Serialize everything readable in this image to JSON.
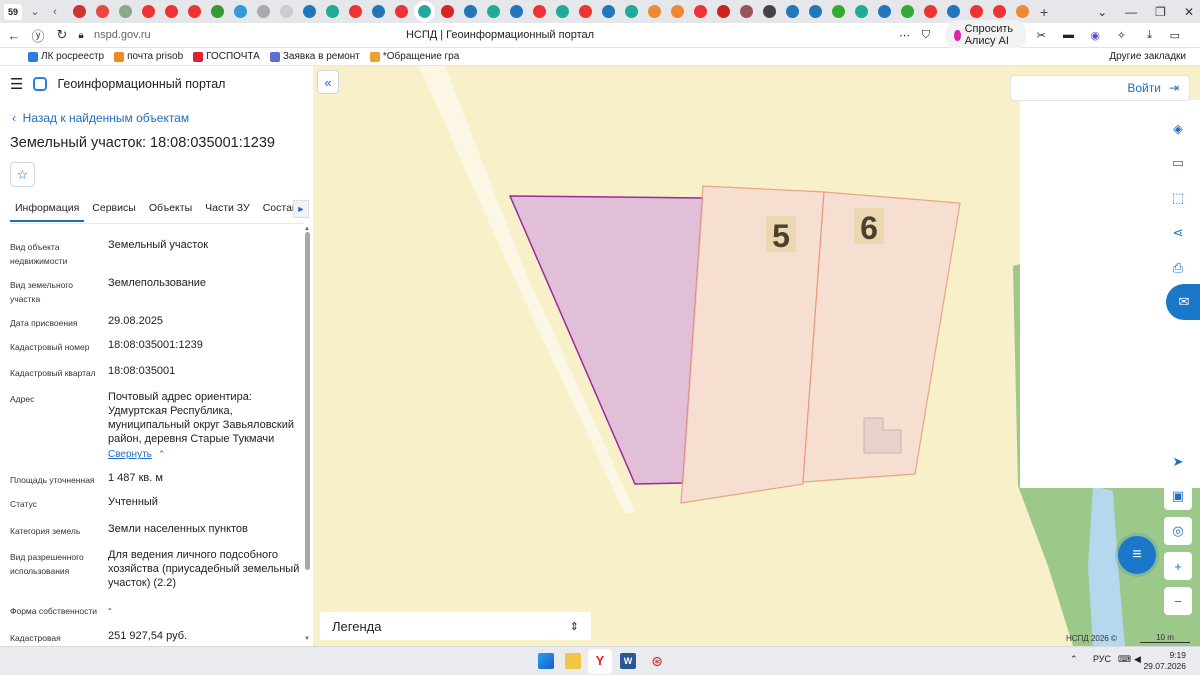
{
  "browser": {
    "tab_count": "59",
    "url": "nspd.gov.ru",
    "page_title": "НСПД | Геоинформационный портал",
    "ask_alice_label": "Спросить Алису AI",
    "bookmarks": [
      {
        "label": "ЛК росреестр",
        "color": "#2a7de1"
      },
      {
        "label": "почта prisob",
        "color": "#f08a1c"
      },
      {
        "label": "ГОСПОЧТА",
        "color": "#d23"
      },
      {
        "label": "Заявка в ремонт",
        "color": "#5a6fd1"
      },
      {
        "label": "*Обращение гра",
        "color": "#e8a32a"
      }
    ],
    "other_bookmarks": "Другие закладки",
    "favicon_colors": [
      "#c33",
      "#e44",
      "#8a8",
      "#e33",
      "#e33",
      "#e33",
      "#393",
      "#39d",
      "#aaa",
      "#ccc",
      "#27b",
      "#2a9",
      "#e33",
      "#27b",
      "#e33",
      "#2a9",
      "#d22",
      "#27b",
      "#2a9",
      "#27b",
      "#e33",
      "#2a9",
      "#e33",
      "#27b",
      "#2a9",
      "#e83",
      "#e83",
      "#e33",
      "#c22",
      "#955",
      "#444",
      "#27b",
      "#27b",
      "#3a3",
      "#2a9",
      "#27b",
      "#3a3",
      "#e33",
      "#27b",
      "#e33",
      "#e33",
      "#e83"
    ]
  },
  "panel": {
    "app_title": "Геоинформационный портал",
    "back_link": "Назад к найденным объектам",
    "title": "Земельный участок: 18:08:035001:1239",
    "tabs": [
      "Информация",
      "Сервисы",
      "Объекты",
      "Части ЗУ",
      "Состав"
    ],
    "collapse_link": "Свернуть",
    "fields": [
      {
        "label": "Вид объекта недвижимости",
        "value": "Земельный участок"
      },
      {
        "label": "Вид земельного участка",
        "value": "Землепользование"
      },
      {
        "label": "Дата присвоения",
        "value": "29.08.2025"
      },
      {
        "label": "Кадастровый номер",
        "value": "18:08:035001:1239"
      },
      {
        "label": "Кадастровый квартал",
        "value": "18:08:035001"
      },
      {
        "label": "Адрес",
        "value": "Почтовый адрес ориентира: Удмуртская Республика, муниципальный округ Завьяловский район, деревня Старые Тукмачи"
      },
      {
        "label": "Площадь уточненная",
        "value": "1 487 кв. м"
      },
      {
        "label": "Статус",
        "value": "Учтенный"
      },
      {
        "label": "Категория земель",
        "value": "Земли населенных пунктов"
      },
      {
        "label": "Вид разрешенного использования",
        "value": "Для ведения личного подсобного хозяйства (приусадебный земельный участок) (2.2)"
      },
      {
        "label": "Форма собственности",
        "value": "-"
      },
      {
        "label": "Кадастровая",
        "value": "251 927,54 руб."
      }
    ]
  },
  "map": {
    "login_label": "Войти",
    "legend_label": "Легенда",
    "parcel_labels": [
      "5",
      "6"
    ],
    "copyright": "НСПД 2026 ©",
    "scale_label": "10 m",
    "colors": {
      "selected_fill": "#e2bfd8",
      "selected_stroke": "#9a2a9e",
      "parcel_fill": "#f6ddd2",
      "parcel_stroke": "#e8967a",
      "terrain": "#f7f0c9",
      "forest": "#9cc98a",
      "river": "#b5d8ee"
    }
  },
  "taskbar": {
    "lang": "РУС",
    "time": "9:19",
    "date": "29.07.2026"
  }
}
